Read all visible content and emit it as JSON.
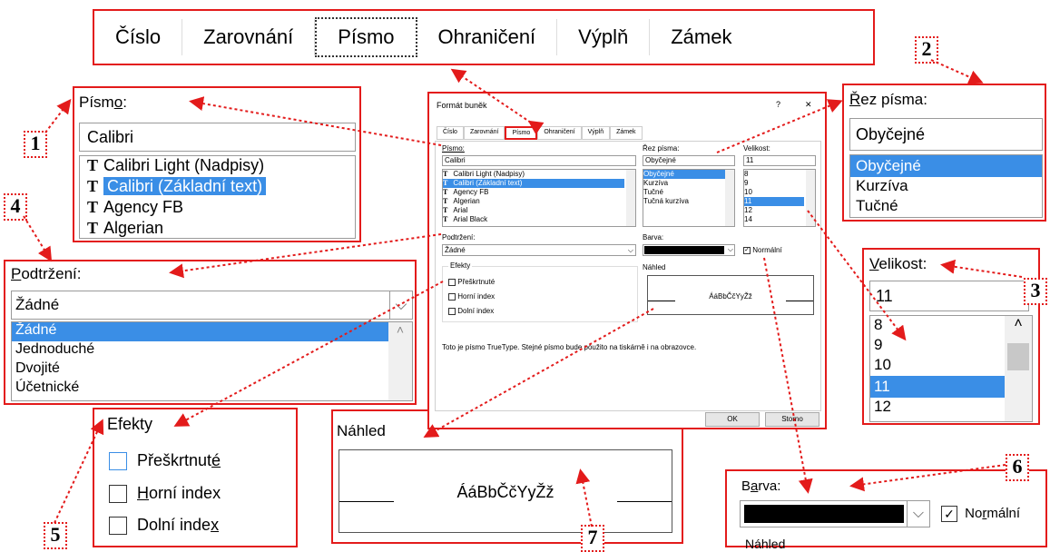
{
  "tabs": [
    "Číslo",
    "Zarovnání",
    "Písmo",
    "Ohraničení",
    "Výplň",
    "Zámek"
  ],
  "markers": [
    "1",
    "2",
    "3",
    "4",
    "5",
    "6",
    "7"
  ],
  "font": {
    "label_pre": "Písm",
    "label_u": "o",
    "label_post": ":",
    "value": "Calibri",
    "items": [
      "Calibri Light (Nadpisy)",
      "Calibri (Základní text)",
      "Agency FB",
      "Algerian"
    ],
    "glyph": "T"
  },
  "style": {
    "label_u": "Ř",
    "label_post": "ez písma:",
    "value": "Obyčejné",
    "items": [
      "Obyčejné",
      "Kurzíva",
      "Tučné"
    ]
  },
  "size": {
    "label_u": "V",
    "label_post": "elikost:",
    "value": "11",
    "items": [
      "8",
      "9",
      "10",
      "11",
      "12"
    ]
  },
  "underline": {
    "label_u": "P",
    "label_post": "odtržení:",
    "value": "Žádné",
    "items": [
      "Žádné",
      "Jednoduché",
      "Dvojité",
      "Účetnické"
    ]
  },
  "effects": {
    "title": "Efekty",
    "items": [
      {
        "pre": "Přeškrtnut",
        "u": "é",
        "post": ""
      },
      {
        "pre": "",
        "u": "H",
        "post": "orní index"
      },
      {
        "pre": "Dolní inde",
        "u": "x",
        "post": ""
      }
    ]
  },
  "preview": {
    "title": "Náhled",
    "sample": "ÁáBbČčYyŽž"
  },
  "color": {
    "label_pre": "B",
    "label_u": "a",
    "label_post": "rva:",
    "normal_pre": "No",
    "normal_u": "r",
    "normal_post": "mální",
    "swatch": "#000000",
    "cut_text": "Náhled"
  },
  "dialog": {
    "title": "Formát buněk",
    "help": "?",
    "close": "✕",
    "tabs": [
      "Číslo",
      "Zarovnání",
      "Písmo",
      "Ohraničení",
      "Výplň",
      "Zámek"
    ],
    "font_label": "Písmo:",
    "font_value": "Calibri",
    "font_items": [
      "Calibri Light (Nadpisy)",
      "Calibri (Základní text)",
      "Agency FB",
      "Algerian",
      "Arial",
      "Arial Black"
    ],
    "style_label": "Řez písma:",
    "style_value": "Obyčejné",
    "style_items": [
      "Obyčejné",
      "Kurzíva",
      "Tučné",
      "Tučná kurzíva"
    ],
    "size_label": "Velikost:",
    "size_value": "11",
    "size_items": [
      "8",
      "9",
      "10",
      "11",
      "12",
      "14"
    ],
    "underline_label": "Podtržení:",
    "underline_value": "Žádné",
    "color_label": "Barva:",
    "normal_label": "Normální",
    "effects_title": "Efekty",
    "effects_items": [
      "Přeškrtnuté",
      "Horní index",
      "Dolní index"
    ],
    "preview_title": "Náhled",
    "preview_sample": "ÁáBbČčYyŽž",
    "note": "Toto je písmo TrueType. Stejné písmo bude použito na tiskárně i na obrazovce.",
    "ok": "OK",
    "cancel": "Storno"
  },
  "accent": "#e31b1b",
  "selection": "#3a8ee6"
}
